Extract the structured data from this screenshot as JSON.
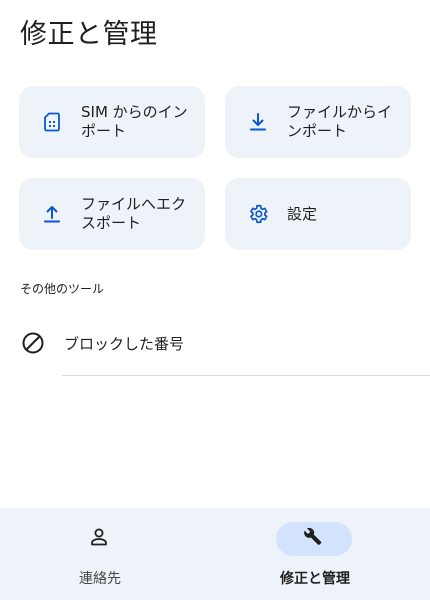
{
  "page": {
    "title": "修正と管理"
  },
  "tiles": {
    "sim_import": {
      "label": "SIM からのインポート",
      "icon": "sim-card-icon"
    },
    "file_import": {
      "label": "ファイルからインポート",
      "icon": "download-icon"
    },
    "file_export": {
      "label": "ファイルへエクスポート",
      "icon": "upload-icon"
    },
    "settings": {
      "label": "設定",
      "icon": "gear-icon"
    }
  },
  "other_tools": {
    "section_label": "その他のツール",
    "items": [
      {
        "label": "ブロックした番号",
        "icon": "block-icon"
      }
    ]
  },
  "bottom_nav": {
    "items": [
      {
        "label": "連絡先",
        "icon": "person-icon",
        "active": false
      },
      {
        "label": "修正と管理",
        "icon": "wrench-icon",
        "active": true
      }
    ]
  },
  "colors": {
    "accent": "#0b57d0",
    "tile_background": "#eef2f9",
    "nav_background": "#eef2f9",
    "nav_active_pill": "#d3e3fd"
  }
}
